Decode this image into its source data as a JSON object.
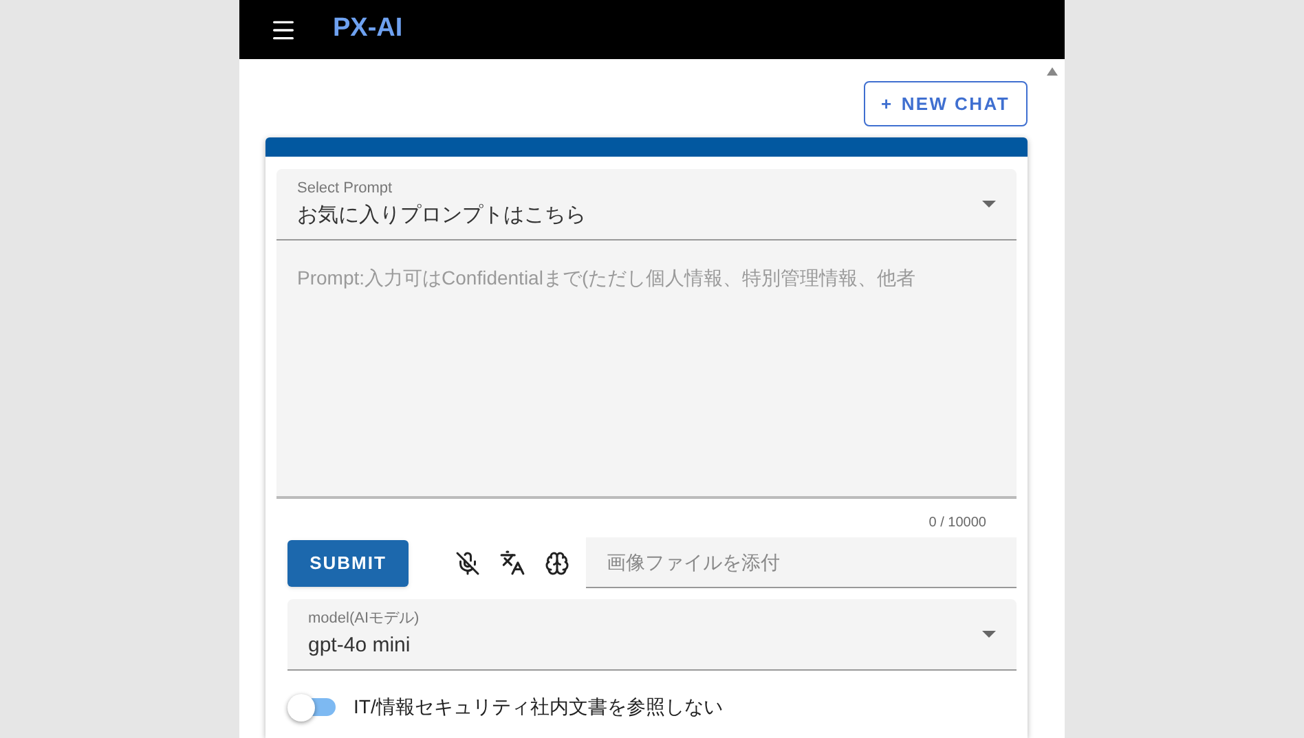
{
  "header": {
    "title": "PX-AI"
  },
  "new_chat_button": {
    "icon": "+",
    "label": "NEW CHAT"
  },
  "prompt_select": {
    "label": "Select Prompt",
    "value": "お気に入りプロンプトはこちら"
  },
  "prompt_input": {
    "placeholder": "Prompt:入力可はConfidentialまで(ただし個人情報、特別管理情報、他者",
    "counter": "0 / 10000"
  },
  "submit_button": {
    "label": "SUBMIT"
  },
  "toolbar": {
    "mic_muted": true
  },
  "image_attach": {
    "placeholder": "画像ファイルを添付"
  },
  "model_select": {
    "label": "model(AIモデル)",
    "value": "gpt-4o mini"
  },
  "internal_docs_switch": {
    "label": "IT/情報セキュリティ社内文書を参照しない",
    "on": false
  }
}
